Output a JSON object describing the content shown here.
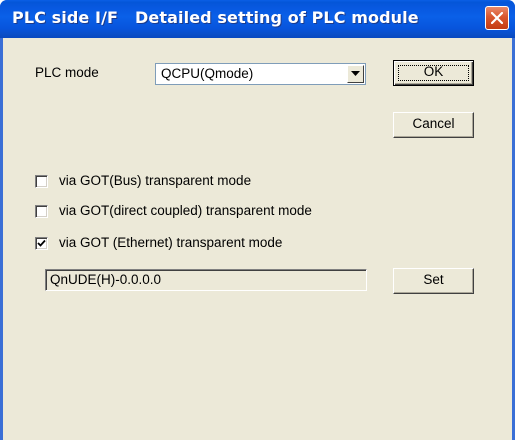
{
  "window": {
    "title": "PLC side I/F   Detailed setting of PLC module"
  },
  "plc_mode": {
    "label": "PLC mode",
    "selected": "QCPU(Qmode)"
  },
  "buttons": {
    "ok": "OK",
    "cancel": "Cancel",
    "set": "Set"
  },
  "options": [
    {
      "label": "via GOT(Bus) transparent mode",
      "checked": false
    },
    {
      "label": "via GOT(direct coupled) transparent mode",
      "checked": false
    },
    {
      "label": "via GOT (Ethernet) transparent mode",
      "checked": true
    }
  ],
  "ethernet_setting": {
    "value": "QnUDE(H)-0.0.0.0"
  },
  "icons": {
    "close": "close-icon",
    "dropdown": "chevron-down-icon",
    "check": "check-icon"
  },
  "colors": {
    "titlebar": "#0a60e8",
    "close_button": "#d9562e",
    "dialog_background": "#ece9d8"
  }
}
